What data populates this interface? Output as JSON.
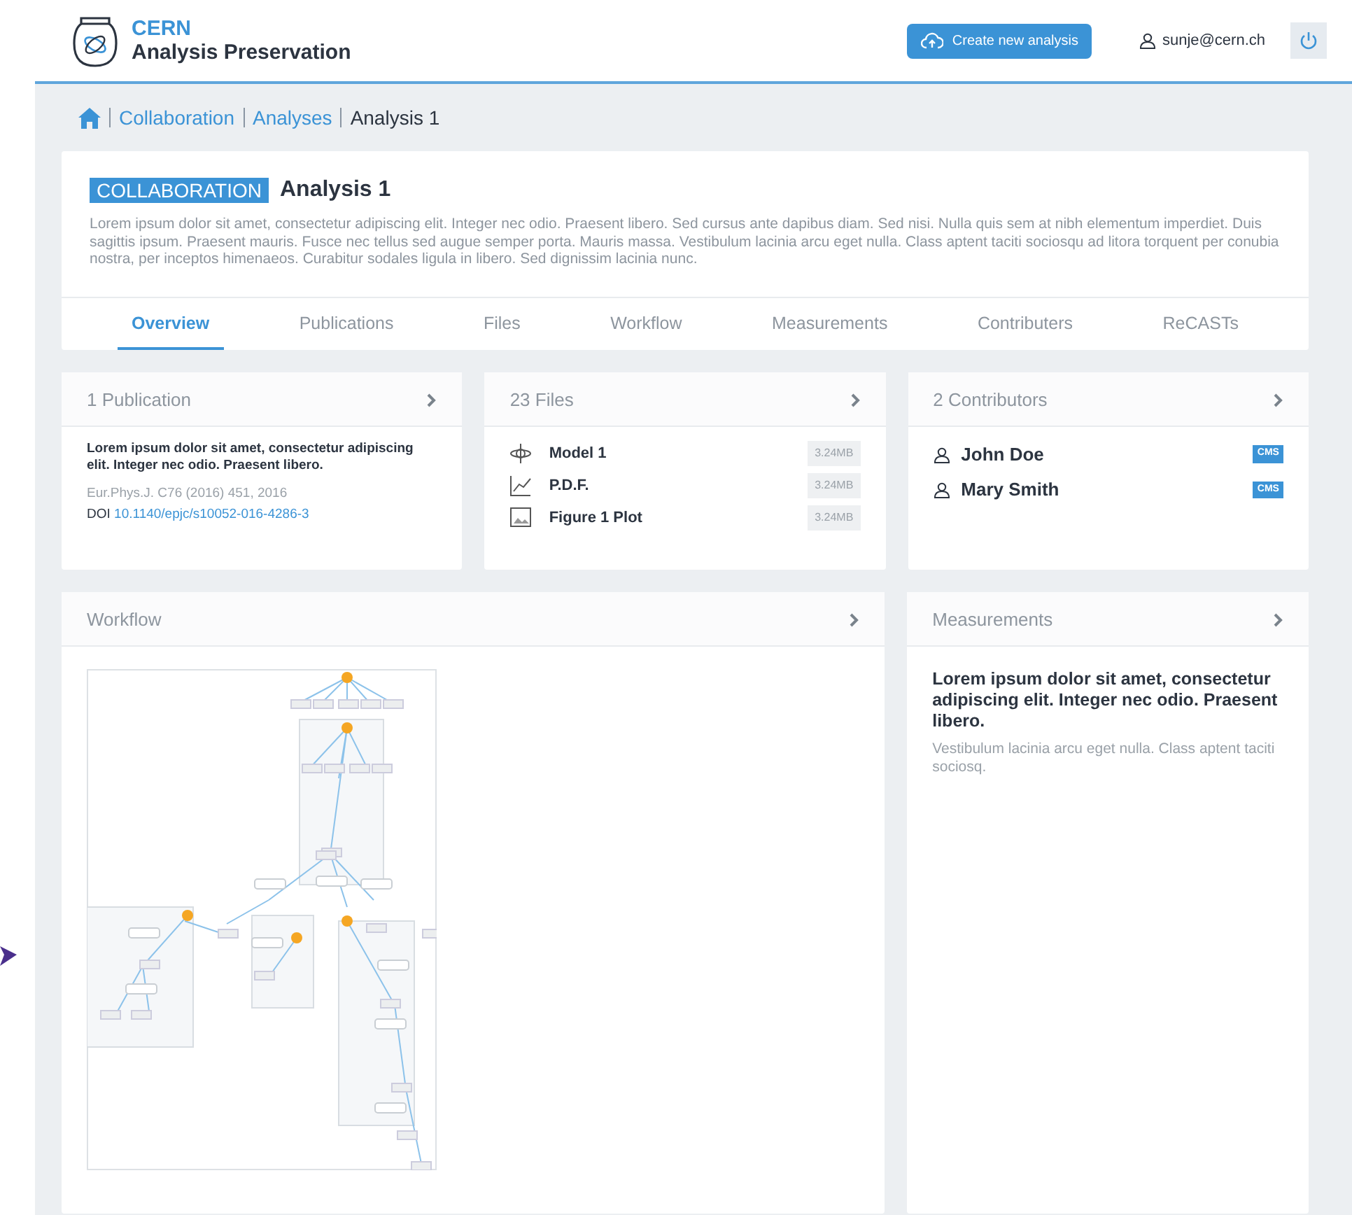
{
  "header": {
    "logo_top": "CERN",
    "logo_bottom": "Analysis Preservation",
    "create_button": "Create new analysis",
    "user": "sunje@cern.ch"
  },
  "breadcrumb": [
    {
      "label": "Collaboration",
      "kind": "link"
    },
    {
      "label": "Analyses",
      "kind": "link"
    },
    {
      "label": "Analysis 1",
      "kind": "current"
    }
  ],
  "analysis": {
    "badge": "COLLABORATION",
    "title": "Analysis 1",
    "description": "Lorem ipsum dolor sit amet, consectetur adipiscing elit. Integer nec odio. Praesent libero. Sed cursus ante dapibus diam. Sed nisi. Nulla quis sem at nibh elementum imperdiet. Duis sagittis ipsum. Praesent mauris. Fusce nec tellus sed augue semper porta. Mauris massa. Vestibulum lacinia arcu eget nulla. Class aptent taciti sociosqu ad litora torquent per conubia nostra, per inceptos himenaeos. Curabitur sodales ligula in libero. Sed dignissim lacinia nunc."
  },
  "tabs": [
    {
      "label": "Overview",
      "selected": true
    },
    {
      "label": "Publications",
      "selected": false
    },
    {
      "label": "Files",
      "selected": false
    },
    {
      "label": "Workflow",
      "selected": false
    },
    {
      "label": "Measurements",
      "selected": false
    },
    {
      "label": "Contributers",
      "selected": false
    },
    {
      "label": "ReCASTs",
      "selected": false
    }
  ],
  "publications": {
    "title": "1 Publication",
    "text": "Lorem ipsum dolor sit amet, consectetur adipiscing elit. Integer nec odio. Praesent libero.",
    "citation": "Eur.Phys.J. C76 (2016) 451, 2016",
    "doi_label": "DOI",
    "doi": "10.1140/epjc/s10052-016-4286-3"
  },
  "files": {
    "title": "23 Files",
    "items": [
      {
        "name": "Model 1",
        "size": "3.24MB",
        "kind": "model"
      },
      {
        "name": "P.D.F.",
        "size": "3.24MB",
        "kind": "plot"
      },
      {
        "name": "Figure 1 Plot",
        "size": "3.24MB",
        "kind": "image"
      }
    ]
  },
  "contributors": {
    "title": "2 Contributors",
    "items": [
      {
        "name": "John Doe",
        "tag": "CMS"
      },
      {
        "name": "Mary Smith",
        "tag": "CMS"
      }
    ]
  },
  "workflow": {
    "title": "Workflow"
  },
  "measurements": {
    "title": "Measurements",
    "lead": "Lorem ipsum dolor sit amet, consectetur adipiscing elit. Integer nec odio. Praesent libero.",
    "text": "Vestibulum lacinia arcu eget nulla. Class aptent taciti sociosq."
  }
}
